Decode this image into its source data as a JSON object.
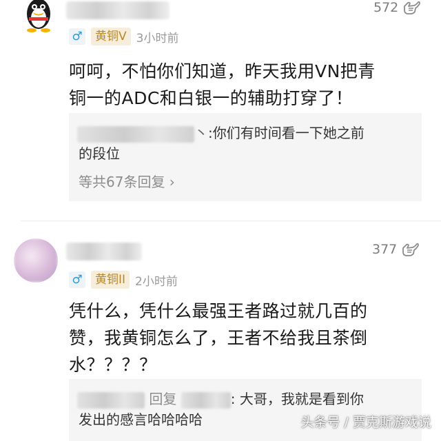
{
  "comments": [
    {
      "likes": "572",
      "rank": "黄铜V",
      "time": "3小时前",
      "gender_icon": "♂",
      "lines": [
        "呵呵，不怕你们知道，昨天我用VN把青",
        "铜一的ADC和白银一的辅助打穿了！"
      ],
      "reply": {
        "lines": [
          ":你们有时间看一下她之前",
          "的段位"
        ],
        "more": "等共67条回复 ›"
      }
    },
    {
      "likes": "377",
      "rank": "黄铜II",
      "time": "2小时前",
      "gender_icon": "♂",
      "lines": [
        "凭什么，凭什么最强王者路过就几百的",
        "赞，我黄铜怎么了，王者不给我且茶倒",
        "水？？？？"
      ],
      "reply": {
        "mid_word": "回复",
        "lines": [
          ": 大哥，我就是看到你",
          "发出的感言哈哈哈哈"
        ]
      }
    }
  ],
  "watermark": "头条号 / 贾克斯游戏说",
  "colors": {
    "rank_bg": "#f6eedb",
    "rank_text": "#b7872c",
    "gender": "#2d9bd8"
  },
  "icons": {
    "like": "shaka-hand-icon",
    "gender": "male-icon"
  }
}
